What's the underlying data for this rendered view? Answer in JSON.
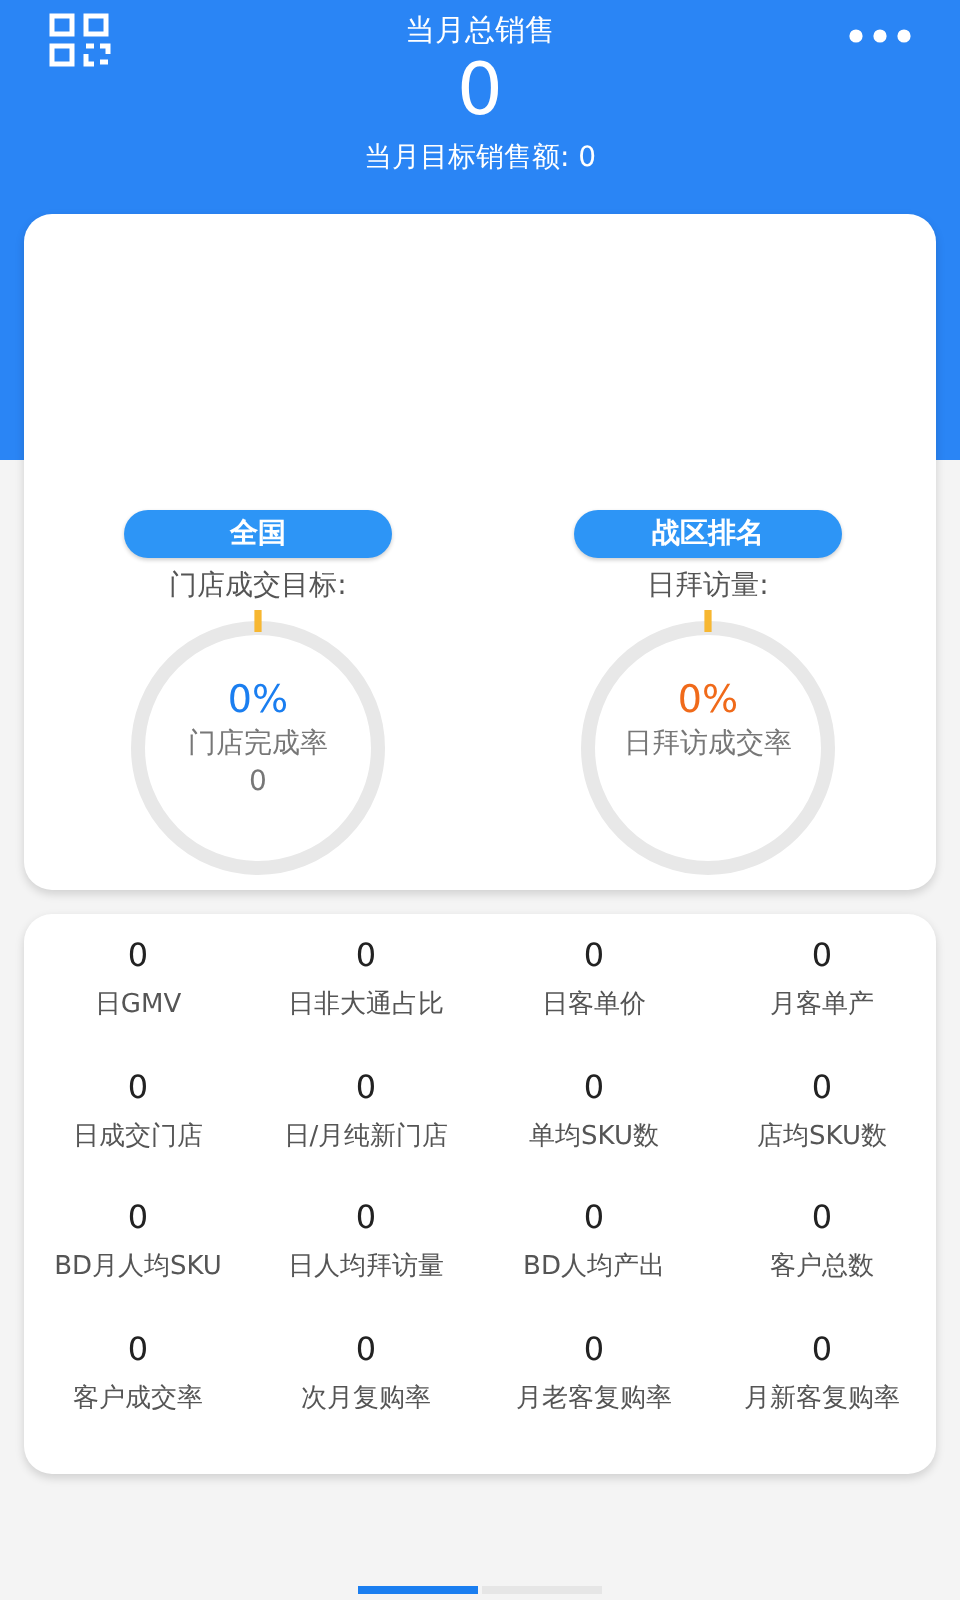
{
  "header": {
    "title": "当月总销售",
    "total": "0",
    "target_label": "当月目标销售额: 0"
  },
  "gauges": [
    {
      "tab": "全国",
      "label": "门店成交目标:",
      "percent": "0%",
      "color": "#1a7ef0",
      "caption": "门店完成率",
      "count": "0"
    },
    {
      "tab": "战区排名",
      "label": "日拜访量:",
      "percent": "0%",
      "color": "#f06a1a",
      "caption": "日拜访成交率"
    }
  ],
  "metrics": [
    {
      "value": "0",
      "label": "日GMV"
    },
    {
      "value": "0",
      "label": "日非大通占比"
    },
    {
      "value": "0",
      "label": "日客单价"
    },
    {
      "value": "0",
      "label": "月客单产"
    },
    {
      "value": "0",
      "label": "日成交门店"
    },
    {
      "value": "0",
      "label": "日/月纯新门店"
    },
    {
      "value": "0",
      "label": "单均SKU数"
    },
    {
      "value": "0",
      "label": "店均SKU数"
    },
    {
      "value": "0",
      "label": "BD月人均SKU"
    },
    {
      "value": "0",
      "label": "日人均拜访量"
    },
    {
      "value": "0",
      "label": "BD人均产出"
    },
    {
      "value": "0",
      "label": "客户总数"
    },
    {
      "value": "0",
      "label": "客户成交率"
    },
    {
      "value": "0",
      "label": "次月复购率"
    },
    {
      "value": "0",
      "label": "月老客复购率"
    },
    {
      "value": "0",
      "label": "月新客复购率"
    }
  ],
  "pager": [
    {
      "selected": true
    },
    {
      "selected": false
    }
  ]
}
